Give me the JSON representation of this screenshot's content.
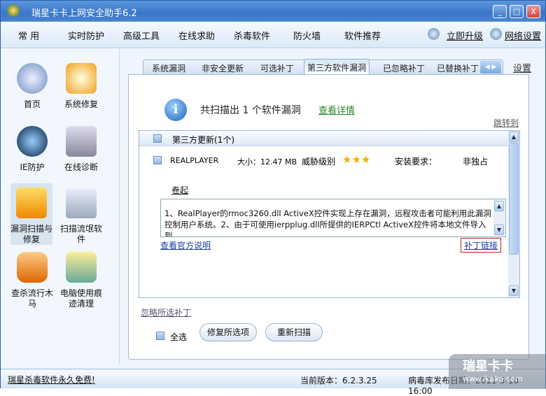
{
  "window": {
    "title": "瑞星卡卡上网安全助手6.2",
    "minimize": "_",
    "maximize": "□",
    "close": "X"
  },
  "menu": {
    "items": [
      "常 用",
      "实时防护",
      "高级工具",
      "在线求助",
      "杀毒软件",
      "防火墙",
      "软件推荐"
    ],
    "upgrade": "立即升级",
    "network": "网络设置"
  },
  "sidebar": {
    "items": [
      "首页",
      "系统修复",
      "IE防护",
      "在线诊断",
      "漏洞扫描与修复",
      "扫描流氓软件",
      "查杀流行木马",
      "电脑使用痕迹清理"
    ]
  },
  "tabs": {
    "items": [
      "系统漏洞",
      "非安全更新",
      "可选补丁",
      "第三方软件漏洞",
      "已忽略补丁",
      "已替换补丁"
    ],
    "active": 3,
    "settings": "设置"
  },
  "scan": {
    "summary": "共扫描出 1 个软件漏洞",
    "details_link": "查看详情",
    "jump": "跳转到"
  },
  "group": {
    "label": "第三方更新(1个)"
  },
  "item": {
    "name": "REALPLAYER",
    "size": "大小：12.47 MB",
    "threat_label": "威胁级别",
    "threat_stars": 3,
    "install_label": "安装要求：",
    "install_value": "非独占",
    "collapse": "卷起",
    "description": "1、RealPlayer的rmoc3260.dll ActiveX控件实现上存在漏洞，远程攻击者可能利用此漏洞控制用户系统。2、由于可使用ierpplug.dll所提供的IERPCtl ActiveX控件将本地文件导入到",
    "official": "查看官方说明",
    "patch_link": "补丁链接"
  },
  "footer": {
    "ignore": "忽略所选补丁",
    "select_all": "全选",
    "repair": "修复所选项",
    "rescan": "重新扫描"
  },
  "status": {
    "promo": "瑞星杀毒软件永久免费!",
    "version": "当前版本：6.2.3.25",
    "db_date": "病毒库发布日期：2011-5-10 16:00"
  },
  "watermark": {
    "brand": "瑞星卡卡",
    "url": "www.ikaka.com"
  }
}
